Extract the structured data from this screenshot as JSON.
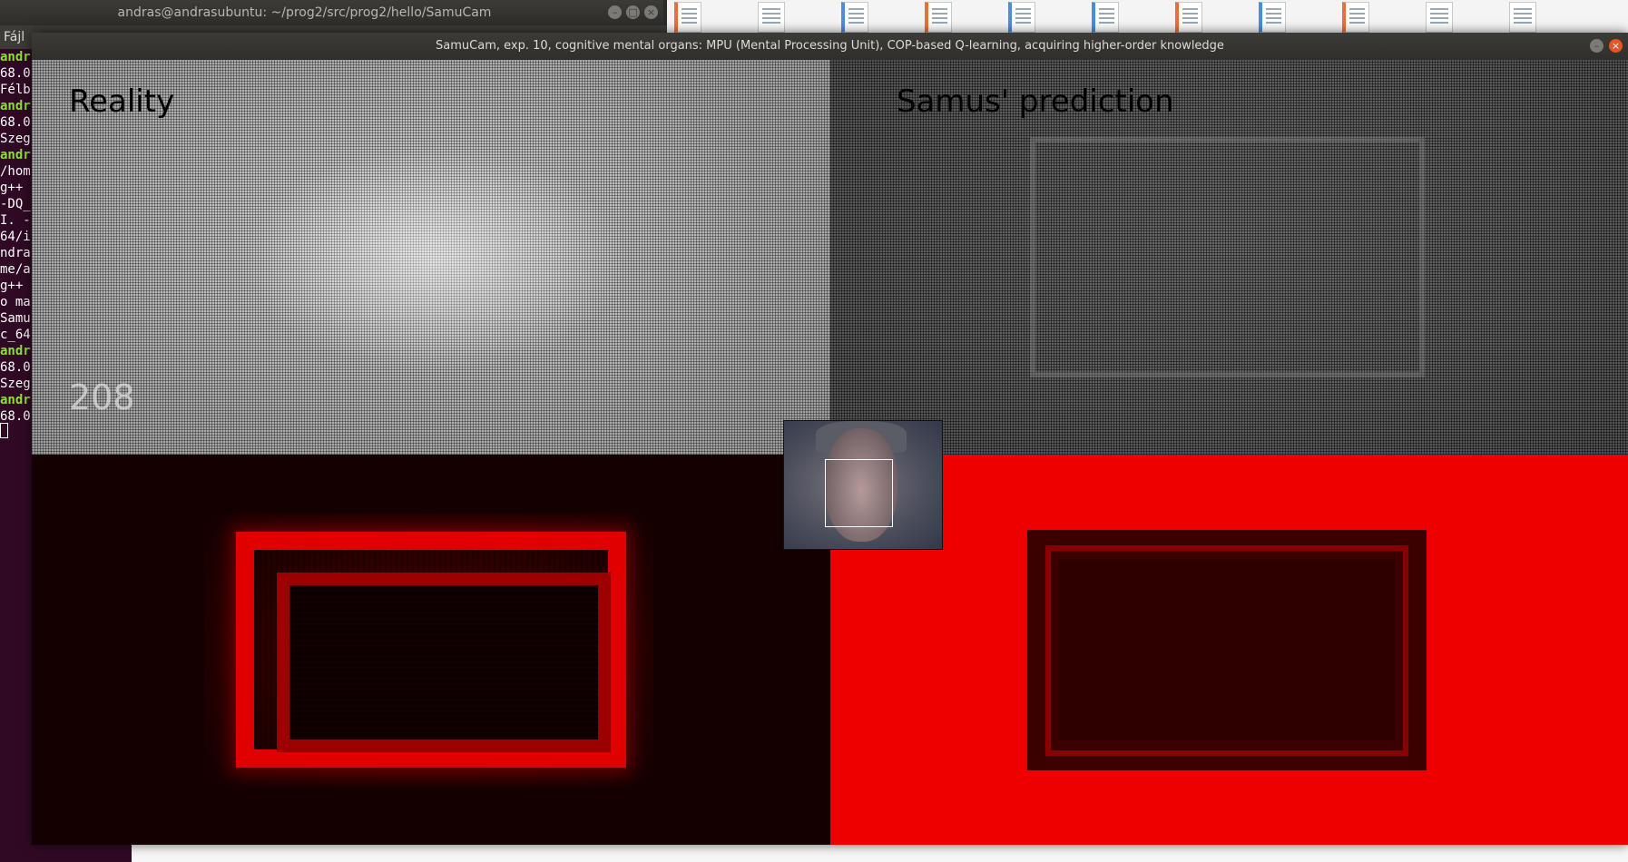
{
  "terminal": {
    "title": "andras@andrasubuntu: ~/prog2/src/prog2/hello/SamuCam",
    "menu_label": "Fájl",
    "lines": [
      {
        "text": "andr",
        "green": true
      },
      {
        "text": "68.0",
        "green": false
      },
      {
        "text": "Félb",
        "green": false
      },
      {
        "text": "andr",
        "green": true
      },
      {
        "text": "68.0",
        "green": false
      },
      {
        "text": "Szeg",
        "green": false
      },
      {
        "text": "andr",
        "green": true
      },
      {
        "text": "/hom",
        "green": false
      },
      {
        "text": "g++ ",
        "green": false
      },
      {
        "text": "-DQ_",
        "green": false
      },
      {
        "text": "I. -",
        "green": false
      },
      {
        "text": "64/i",
        "green": false
      },
      {
        "text": "ndra",
        "green": false
      },
      {
        "text": "me/a",
        "green": false
      },
      {
        "text": "g++ ",
        "green": false
      },
      {
        "text": "o ma",
        "green": false
      },
      {
        "text": "Samu",
        "green": false
      },
      {
        "text": "c_64",
        "green": false
      },
      {
        "text": "andr",
        "green": true
      },
      {
        "text": "68.0",
        "green": false
      },
      {
        "text": "Szeg",
        "green": false
      },
      {
        "text": "andr",
        "green": true
      },
      {
        "text": "68.0",
        "green": false
      }
    ]
  },
  "samucam": {
    "title": "SamuCam, exp. 10, cognitive mental organs: MPU (Mental Processing Unit), COP-based Q-learning, acquiring higher-order knowledge",
    "reality_label": "Reality",
    "prediction_label": "Samus' prediction",
    "frame_counter": "208"
  },
  "file_icons": [
    "orange",
    "plain",
    "blue",
    "orange",
    "blue",
    "blue",
    "orange",
    "blue",
    "orange",
    "plain",
    "plain"
  ],
  "icons": {
    "minimize": "minimize-icon",
    "maximize": "maximize-icon",
    "close": "close-icon"
  }
}
